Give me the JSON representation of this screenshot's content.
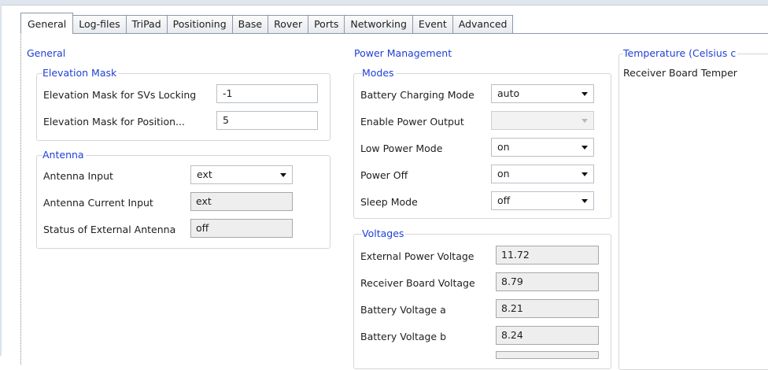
{
  "tabs": [
    "General",
    "Log-files",
    "TriPad",
    "Positioning",
    "Base",
    "Rover",
    "Ports",
    "Networking",
    "Event",
    "Advanced"
  ],
  "general": {
    "title": "General",
    "elevation_mask": {
      "title": "Elevation Mask",
      "svs_locking_label": "Elevation Mask for SVs Locking",
      "svs_locking_value": "-1",
      "position_label": "Elevation Mask for Position...",
      "position_value": "5"
    },
    "antenna": {
      "title": "Antenna",
      "input_label": "Antenna Input",
      "input_value": "ext",
      "current_input_label": "Antenna Current Input",
      "current_input_value": "ext",
      "status_label": "Status of External Antenna",
      "status_value": "off"
    }
  },
  "power": {
    "title": "Power Management",
    "modes": {
      "title": "Modes",
      "battery_charging_label": "Battery Charging Mode",
      "battery_charging_value": "auto",
      "enable_power_output_label": "Enable Power Output",
      "enable_power_output_value": "",
      "low_power_label": "Low Power Mode",
      "low_power_value": "on",
      "power_off_label": "Power Off",
      "power_off_value": "on",
      "sleep_label": "Sleep Mode",
      "sleep_value": "off"
    },
    "voltages": {
      "title": "Voltages",
      "external_label": "External Power Voltage",
      "external_value": "11.72",
      "receiver_label": "Receiver Board Voltage",
      "receiver_value": "8.79",
      "battery_a_label": "Battery Voltage a",
      "battery_a_value": "8.21",
      "battery_b_label": "Battery Voltage b",
      "battery_b_value": "8.24"
    }
  },
  "temperature": {
    "title": "Temperature (Celsius c",
    "receiver_label": "Receiver Board Temper"
  }
}
